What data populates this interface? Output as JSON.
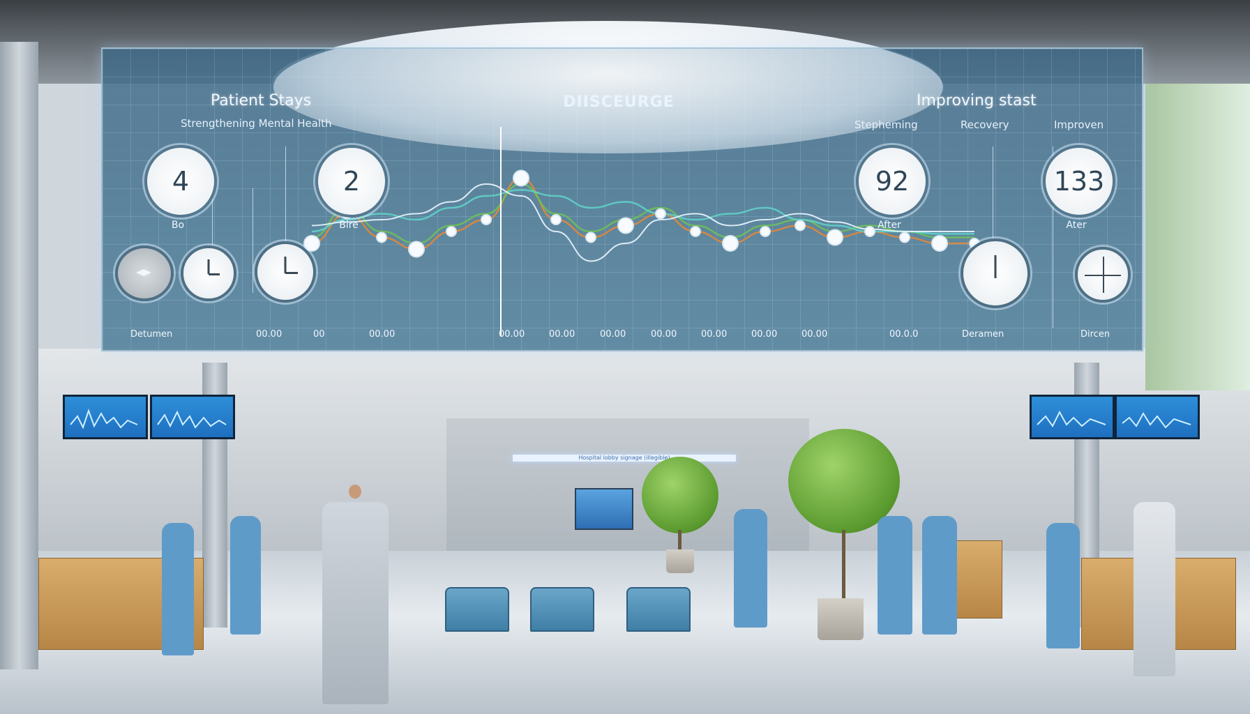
{
  "scene": {
    "setting": "hospital lobby",
    "wall_sign_text": "Hospital lobby signage (illegible)"
  },
  "dashboard": {
    "left_title": "Patient Stays",
    "left_subtitle": "Strengthening Mental Health",
    "center_title": "DIISCEURGE",
    "right_title": "Improving stast",
    "right_subtitles": [
      "Stepheming",
      "Recovery",
      "Improven"
    ],
    "stats": [
      {
        "value": "4",
        "label": "Bo"
      },
      {
        "value": "2",
        "label": "Bire"
      },
      {
        "value": "92",
        "label": "After"
      },
      {
        "value": "133",
        "label": "Ater"
      }
    ],
    "bottom_labels": {
      "left": "Detumen",
      "right_1": "Deramen",
      "right_2": "Dircen"
    },
    "tick_labels": [
      "00.00",
      "00",
      "00.00",
      "00.00",
      "00.00",
      "00.00",
      "00.00",
      "00.00",
      "00.00",
      "00.00",
      "00.0.0"
    ],
    "icons": [
      "diamond-icon",
      "clock-icon",
      "clock-icon",
      "clock-down-icon",
      "crosshair-icon"
    ]
  },
  "chart_data": {
    "type": "line",
    "title": "DIISCEURGE",
    "xlabel": "",
    "ylabel": "",
    "x": [
      0,
      1,
      2,
      3,
      4,
      5,
      6,
      7,
      8,
      9,
      10,
      11,
      12,
      13,
      14,
      15,
      16,
      17,
      18,
      19
    ],
    "series": [
      {
        "name": "orange",
        "color": "#e0883a",
        "values": [
          0.3,
          0.55,
          0.35,
          0.25,
          0.4,
          0.5,
          0.85,
          0.5,
          0.35,
          0.45,
          0.55,
          0.4,
          0.3,
          0.4,
          0.45,
          0.35,
          0.4,
          0.35,
          0.3,
          0.3
        ]
      },
      {
        "name": "green",
        "color": "#6fbf5a",
        "values": [
          0.35,
          0.6,
          0.4,
          0.3,
          0.45,
          0.55,
          0.8,
          0.55,
          0.4,
          0.5,
          0.6,
          0.45,
          0.35,
          0.45,
          0.5,
          0.4,
          0.45,
          0.4,
          0.35,
          0.35
        ]
      },
      {
        "name": "teal",
        "color": "#5fd0c8",
        "values": [
          0.4,
          0.5,
          0.55,
          0.5,
          0.6,
          0.7,
          0.75,
          0.7,
          0.6,
          0.65,
          0.55,
          0.5,
          0.55,
          0.6,
          0.5,
          0.45,
          0.4,
          0.4,
          0.38,
          0.38
        ]
      },
      {
        "name": "white",
        "color": "#eaf6ff",
        "values": [
          0.45,
          0.48,
          0.5,
          0.55,
          0.65,
          0.8,
          0.7,
          0.4,
          0.15,
          0.3,
          0.5,
          0.55,
          0.45,
          0.5,
          0.55,
          0.48,
          0.42,
          0.4,
          0.4,
          0.4
        ]
      }
    ],
    "ylim": [
      0,
      1
    ],
    "grid": true
  }
}
